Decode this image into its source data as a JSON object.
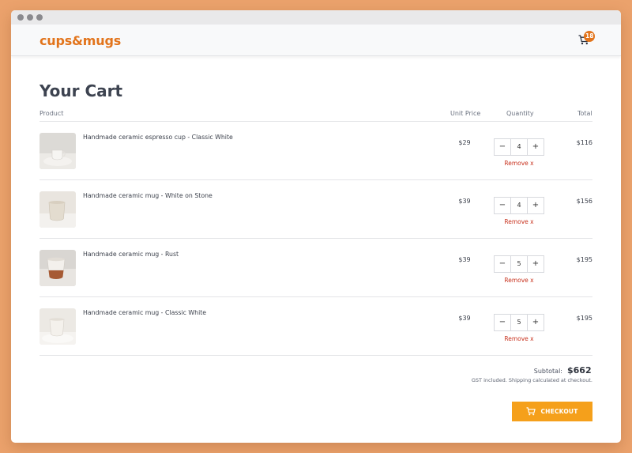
{
  "brand": {
    "name": "cups&mugs",
    "accent_color": "#e2741b"
  },
  "header": {
    "cart_count": "18",
    "cart_icon": "cart-icon"
  },
  "cart": {
    "title": "Your Cart",
    "columns": {
      "product": "Product",
      "unit_price": "Unit Price",
      "quantity": "Quantity",
      "total": "Total"
    },
    "items": [
      {
        "name": "Handmade ceramic espresso cup - Classic White",
        "price": "$29",
        "qty": "4",
        "total": "$116",
        "remove": "Remove x",
        "minus": "−",
        "plus": "+"
      },
      {
        "name": "Handmade ceramic mug - White on Stone",
        "price": "$39",
        "qty": "4",
        "total": "$156",
        "remove": "Remove x",
        "minus": "−",
        "plus": "+"
      },
      {
        "name": "Handmade ceramic mug - Rust",
        "price": "$39",
        "qty": "5",
        "total": "$195",
        "remove": "Remove x",
        "minus": "−",
        "plus": "+"
      },
      {
        "name": "Handmade ceramic mug - Classic White",
        "price": "$39",
        "qty": "5",
        "total": "$195",
        "remove": "Remove x",
        "minus": "−",
        "plus": "+"
      }
    ],
    "subtotal_label": "Subtotal:",
    "subtotal_value": "$662",
    "shipping_note": "GST included. Shipping calculated at checkout.",
    "checkout_label": "CHECKOUT",
    "checkout_color": "#f5a01b"
  }
}
